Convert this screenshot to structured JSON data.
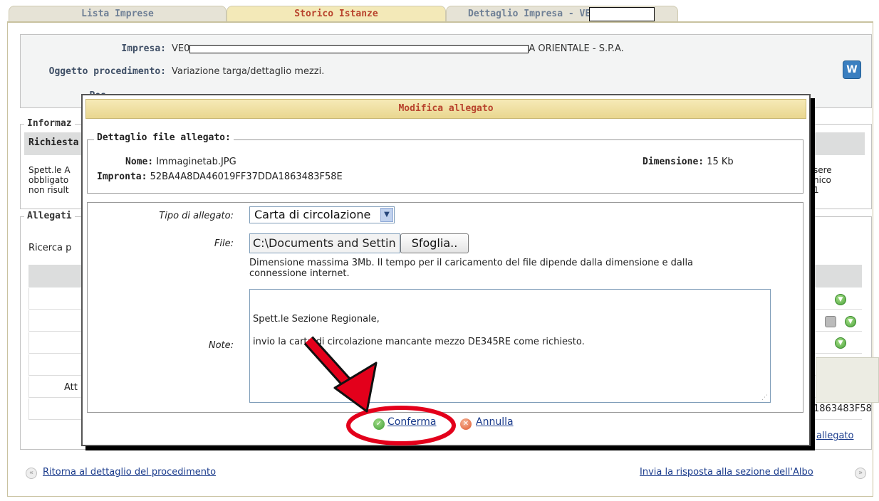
{
  "tabs": [
    {
      "label": "Lista Imprese"
    },
    {
      "label": "Storico Istanze"
    },
    {
      "label": "Dettaglio Impresa - VE"
    }
  ],
  "info": {
    "impresa_label": "Impresa:",
    "impresa_prefix": "VE0",
    "impresa_suffix": "A ORIENTALE - S.P.A.",
    "oggetto_label": "Oggetto procedimento:",
    "oggetto_value": "Variazione targa/dettaglio mezzi.",
    "posizione_label": "Pos"
  },
  "background": {
    "informazioni_legend": "Informaz",
    "richiesta_header": "Richiesta",
    "spett_lines": [
      "Spett.le A",
      "obbligato",
      "non risult"
    ],
    "right_fragments": [
      "sere",
      "nico",
      "1"
    ],
    "allegati_legend": "Allegati",
    "ricerca_label": "Ricerca p",
    "att_label": "Att",
    "impronta_fragment": "1863483F58",
    "allegato_link": "allegato"
  },
  "footer": {
    "back_link": "Ritorna al dettaglio del procedimento",
    "send_link": "Invia la risposta alla sezione dell'Albo"
  },
  "modal": {
    "title": "Modifica allegato",
    "detail_legend": "Dettaglio file allegato:",
    "nome_label": "Nome:",
    "nome_value": "Immaginetab.JPG",
    "impronta_label": "Impronta:",
    "impronta_value": "52BA4A8DA46019FF37DDA1863483F58E",
    "dimensione_label": "Dimensione:",
    "dimensione_value": "15 Kb",
    "tipo_label": "Tipo di allegato:",
    "tipo_value": "Carta di circolazione",
    "file_label": "File:",
    "file_value": "C:\\Documents and Settin",
    "browse_label": "Sfoglia..",
    "hint_line1": "Dimensione massima 3Mb. Il tempo per il caricamento del file dipende dalla dimensione e dalla",
    "hint_line2": "connessione internet.",
    "note_label": "Note:",
    "note_line1": "Spett.le Sezione Regionale,",
    "note_line2": "invio la carta di circolazione mancante mezzo DE345RE come richiesto.",
    "confirm_label": "Conferma",
    "cancel_label": "Annulla"
  },
  "colors": {
    "header_text": "#b8432d",
    "link": "#1a3b8c",
    "annotation": "#e3001b"
  }
}
